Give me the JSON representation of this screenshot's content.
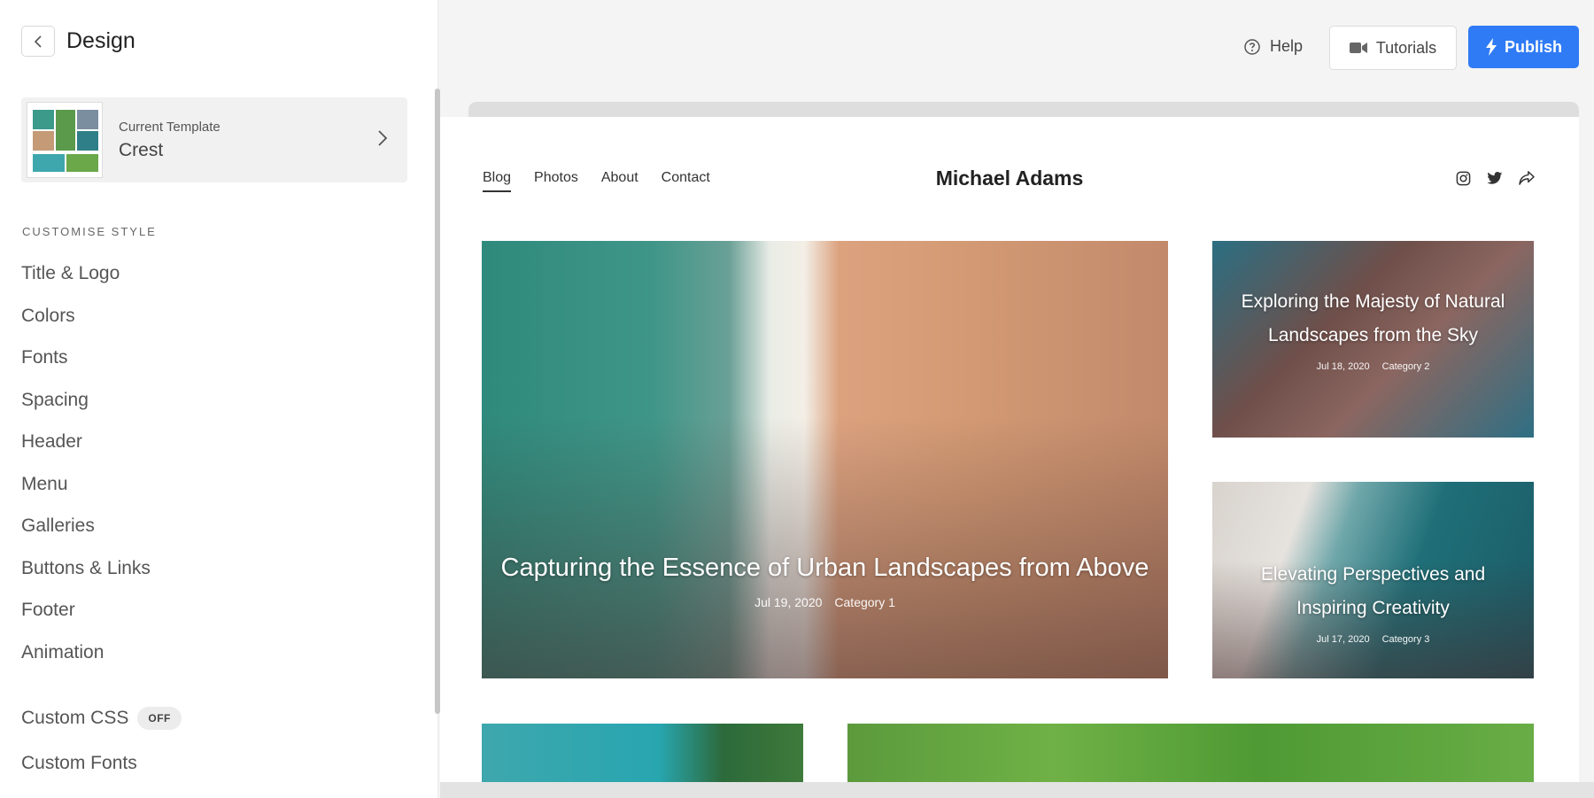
{
  "sidebar": {
    "title": "Design",
    "template": {
      "label": "Current Template",
      "name": "Crest"
    },
    "section_label": "CUSTOMISE STYLE",
    "menu": [
      "Title & Logo",
      "Colors",
      "Fonts",
      "Spacing",
      "Header",
      "Menu",
      "Galleries",
      "Buttons & Links",
      "Footer",
      "Animation"
    ],
    "custom_css": {
      "label": "Custom CSS",
      "state": "OFF"
    },
    "custom_fonts": "Custom Fonts"
  },
  "topbar": {
    "help": "Help",
    "tutorials": "Tutorials",
    "publish": "Publish"
  },
  "preview": {
    "nav": [
      "Blog",
      "Photos",
      "About",
      "Contact"
    ],
    "brand": "Michael Adams",
    "posts": [
      {
        "title": "Capturing the Essence of Urban Landscapes from Above",
        "date": "Jul 19, 2020",
        "category": "Category 1"
      },
      {
        "title": "Exploring the Majesty of Natural Landscapes from the Sky",
        "date": "Jul 18, 2020",
        "category": "Category 2"
      },
      {
        "title": "Elevating Perspectives and Inspiring Creativity",
        "date": "Jul 17, 2020",
        "category": "Category 3"
      }
    ]
  },
  "colors": {
    "accent": "#2f7bf5",
    "sidebar_bg": "#ffffff",
    "canvas_bg": "#f4f4f4"
  }
}
